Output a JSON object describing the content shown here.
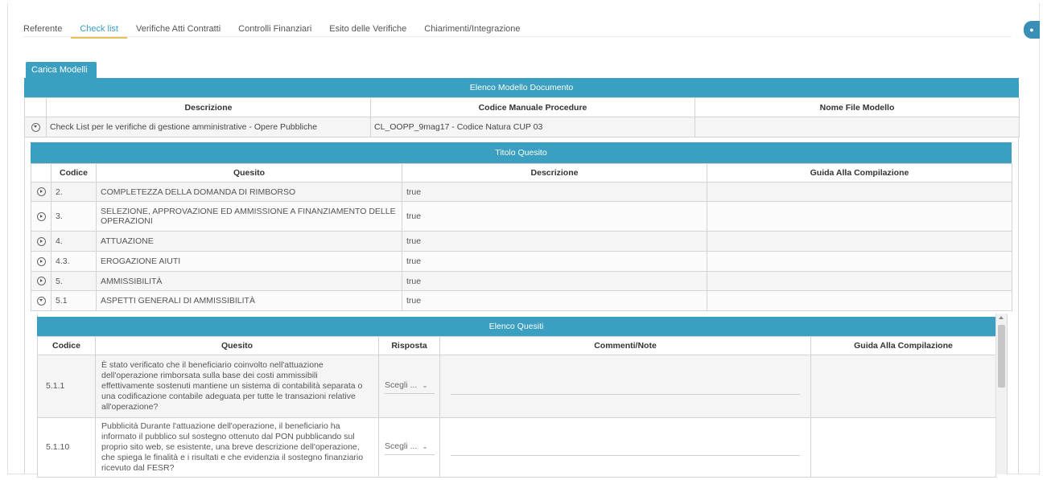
{
  "tabs": [
    {
      "label": "Referente"
    },
    {
      "label": "Check list"
    },
    {
      "label": "Verifiche Atti Contratti"
    },
    {
      "label": "Controlli Finanziari"
    },
    {
      "label": "Esito delle Verifiche"
    },
    {
      "label": "Chiarimenti/Integrazione"
    }
  ],
  "active_tab": "Check list",
  "carica_modelli": "Carica Modelli",
  "elenco_modello": {
    "title": "Elenco Modello Documento",
    "headers": {
      "descrizione": "Descrizione",
      "codice": "Codice Manuale Procedure",
      "nome_file": "Nome File Modello"
    },
    "row": {
      "descrizione": "Check List per le verifiche di gestione amministrative - Opere Pubbliche",
      "codice": "CL_OOPP_9mag17 - Codice Natura CUP 03",
      "nome_file": ""
    }
  },
  "titolo_quesito": {
    "title": "Titolo Quesito",
    "headers": {
      "codice": "Codice",
      "quesito": "Quesito",
      "descrizione": "Descrizione",
      "guida": "Guida Alla Compilazione"
    },
    "rows": [
      {
        "codice": "2.",
        "quesito": "COMPLETEZZA DELLA DOMANDA DI RIMBORSO",
        "descrizione": "true",
        "guida": ""
      },
      {
        "codice": "3.",
        "quesito": "SELEZIONE, APPROVAZIONE ED AMMISSIONE A FINANZIAMENTO DELLE OPERAZIONI",
        "descrizione": "true",
        "guida": ""
      },
      {
        "codice": "4.",
        "quesito": "ATTUAZIONE",
        "descrizione": "true",
        "guida": ""
      },
      {
        "codice": "4.3.",
        "quesito": "EROGAZIONE AIUTI",
        "descrizione": "true",
        "guida": ""
      },
      {
        "codice": "5.",
        "quesito": "AMMISSIBILITÀ",
        "descrizione": "true",
        "guida": ""
      },
      {
        "codice": "5.1",
        "quesito": "ASPETTI GENERALI DI AMMISSIBILITÀ",
        "descrizione": "true",
        "guida": ""
      }
    ]
  },
  "elenco_quesiti": {
    "title": "Elenco Quesiti",
    "headers": {
      "codice": "Codice",
      "quesito": "Quesito",
      "risposta": "Risposta",
      "commenti": "Commenti/Note",
      "guida": "Guida Alla Compilazione"
    },
    "rows": [
      {
        "codice": "5.1.1",
        "quesito": "È stato verificato che il beneficiario coinvolto nell'attuazione dell'operazione rimborsata sulla base dei costi ammissibili effettivamente sostenuti mantiene un sistema di contabilità separata o una codificazione contabile adeguata per tutte le transazioni relative all'operazione?",
        "risposta": "Scegli ...",
        "commenti": "",
        "guida": ""
      },
      {
        "codice": "5.1.10",
        "quesito": "Pubblicità Durante l'attuazione dell'operazione, il beneficiario ha informato il pubblico sul sostegno ottenuto dal PON pubblicando sul proprio sito web, se esistente, una breve descrizione dell'operazione, che spiega le finalità e i risultati e che evidenzia il sostegno finanziario ricevuto dal FESR?",
        "risposta": "Scegli ...",
        "commenti": "",
        "guida": ""
      }
    ]
  },
  "icons": {
    "expand": "chevron-circle-icon",
    "user": "user-badge-icon"
  },
  "colors": {
    "accent": "#3a9fc0",
    "tab_underline": "#e6c15a"
  }
}
